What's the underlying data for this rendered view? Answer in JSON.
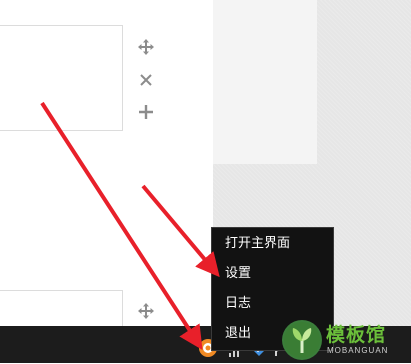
{
  "context_menu": {
    "items": [
      {
        "label": "打开主界面"
      },
      {
        "label": "设置"
      },
      {
        "label": "日志"
      },
      {
        "label": "退出"
      }
    ]
  },
  "tray": {
    "icons": [
      "app-tray-icon",
      "network-icon",
      "security-shield-icon",
      "flag-icon"
    ]
  },
  "watermark": {
    "title": "模板馆",
    "subtitle": "MOBANGUAN"
  },
  "controls": [
    "move-icon",
    "close-icon",
    "add-icon"
  ],
  "colors": {
    "arrow": "#e8202a",
    "menu_bg": "#121212",
    "taskbar_bg": "#1c1c1c",
    "watermark_green": "#6bbf3a"
  }
}
